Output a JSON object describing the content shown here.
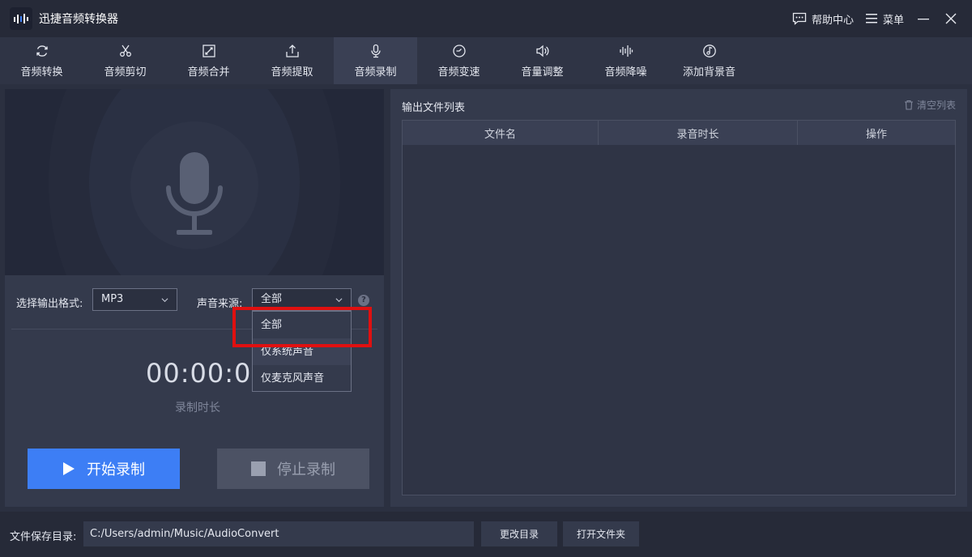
{
  "app": {
    "title": "迅捷音频转换器",
    "help_label": "帮助中心",
    "menu_label": "菜单"
  },
  "tabs": [
    {
      "label": "音频转换",
      "icon": "refresh-icon"
    },
    {
      "label": "音频剪切",
      "icon": "scissors-icon"
    },
    {
      "label": "音频合并",
      "icon": "merge-icon"
    },
    {
      "label": "音频提取",
      "icon": "upload-icon"
    },
    {
      "label": "音频录制",
      "icon": "microphone-icon",
      "active": true
    },
    {
      "label": "音频变速",
      "icon": "speed-icon"
    },
    {
      "label": "音量调整",
      "icon": "speaker-icon"
    },
    {
      "label": "音频降噪",
      "icon": "waveform-icon"
    },
    {
      "label": "添加背景音",
      "icon": "music-note-icon"
    }
  ],
  "recorder": {
    "format_label": "选择输出格式:",
    "format_value": "MP3",
    "source_label": "声音来源:",
    "source_value": "全部",
    "help_glyph": "?",
    "source_options": [
      "全部",
      "仅系统声音",
      "仅麦克风声音"
    ],
    "timer": "00:00:00",
    "timer_label": "录制时长",
    "start_label": "开始录制",
    "stop_label": "停止录制"
  },
  "output": {
    "title": "输出文件列表",
    "clear_label": "清空列表",
    "columns": [
      "文件名",
      "录音时长",
      "操作"
    ]
  },
  "footer": {
    "path_label": "文件保存目录:",
    "path_value": "C:/Users/admin/Music/AudioConvert",
    "change_dir_label": "更改目录",
    "open_folder_label": "打开文件夹"
  },
  "colors": {
    "accent": "#3d7ef5",
    "highlight": "#e01010",
    "background": "#2b3040"
  }
}
